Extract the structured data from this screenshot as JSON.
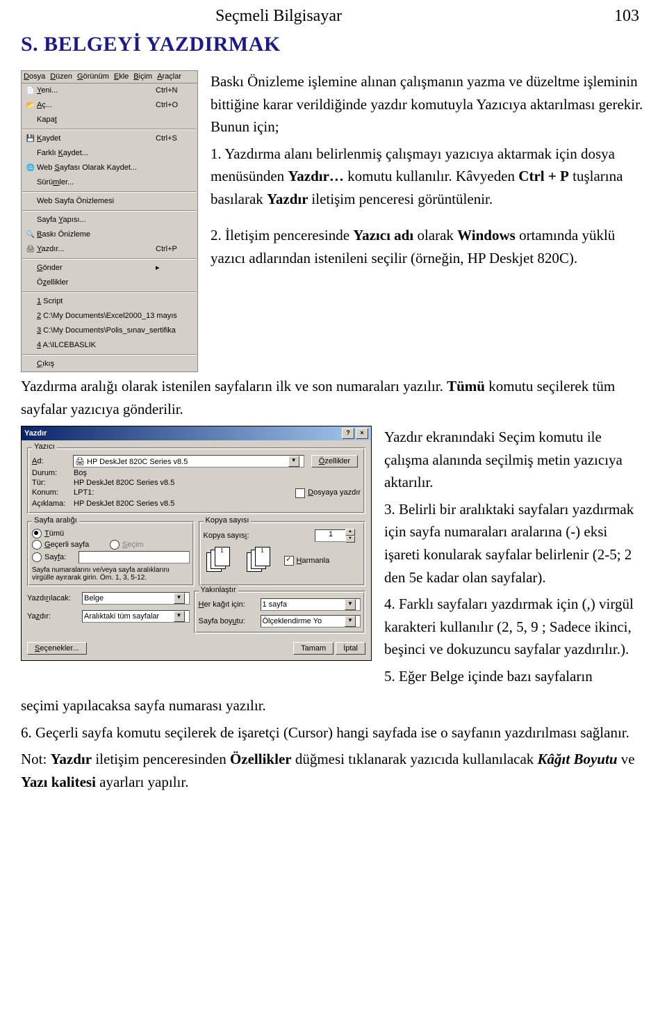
{
  "header": {
    "course": "Seçmeli Bilgisayar",
    "page": "103"
  },
  "section_title": "S. BELGEYİ YAZDIRMAK",
  "para_intro_1": "Baskı Önizleme işlemine alınan çalışmanın yazma ve düzeltme işleminin bittiğine karar verildiğinde yazdır komutuyla Yazıcıya aktarılması gerekir. Bunun için;",
  "para_step1_a": "1. Yazdırma alanı belirlenmiş çalışmayı yazıcıya aktarmak için dosya menüsünden ",
  "para_step1_b": "Yazdır…",
  "para_step1_c": " komutu  kullanılır. Kâvyeden ",
  "para_step1_d": "Ctrl + P",
  "para_step1_e": "  tuşlarına basılarak ",
  "para_step1_f": "Yazdır ",
  "para_step1_g": "iletişim penceresi görüntülenir.",
  "para_step2_a": "2. İletişim penceresinde ",
  "para_step2_b": "Yazıcı adı",
  "para_step2_c": " olarak ",
  "para_step2_d": "Windows",
  "para_step2_e": " ortamında yüklü yazıcı adlarından istenileni seçilir (örneğin, HP Deskjet 820C).",
  "para_mid_a": "Yazdırma aralığı olarak istenilen sayfaların ilk ve son numaraları yazılır. ",
  "para_mid_b": "Tümü",
  "para_mid_c": " komutu seçilerek  tüm sayfalar yazıcıya gönderilir.",
  "right_1": "Yazdır ekranındaki Seçim komutu ile çalışma alanında seçilmiş metin yazıcıya aktarılır.",
  "right_2": " 3. Belirli bir aralıktaki sayfaları yazdırmak için sayfa numaraları aralarına (-) eksi işareti konularak sayfalar belirlenir   (2-5; 2 den 5e kadar olan sayfalar).",
  "right_3": "4. Farklı sayfaları yazdırmak için (,) virgül karakteri kullanılır (2, 5, 9 ; Sadece  ikinci, beşinci ve dokuzuncu sayfalar yazdırılır.).",
  "right_4": "5. Eğer Belge içinde bazı sayfaların",
  "foot_1": "seçimi yapılacaksa sayfa numarası yazılır.",
  "foot_2": "6. Geçerli sayfa komutu seçilerek de işaretçi (Cursor) hangi sayfada ise o sayfanın yazdırılması sağlanır.",
  "foot_3a": "Not:  ",
  "foot_3b": "Yazdır",
  "foot_3c": " iletişim penceresinden ",
  "foot_3d": "Özellikler",
  "foot_3e": " düğmesi tıklanarak yazıcıda kullanılacak ",
  "foot_3f": "Kâğıt Boyutu",
  "foot_3g": " ve ",
  "foot_3h": "Yazı kalitesi",
  "foot_3i": " ayarları yapılır.",
  "menu": {
    "bar": [
      "Dosya",
      "Düzen",
      "Görünüm",
      "Ekle",
      "Biçim",
      "Araçlar"
    ],
    "bar_ul_idx": [
      0,
      0,
      0,
      0,
      0,
      0
    ],
    "items": [
      {
        "icon": "📄",
        "label": "Yeni...",
        "sc": "Ctrl+N",
        "ul": 0
      },
      {
        "icon": "📂",
        "label": "Aç...",
        "sc": "Ctrl+O",
        "ul": 0
      },
      {
        "icon": "",
        "label": "Kapat",
        "sc": "",
        "ul": 4
      },
      {
        "sep": true
      },
      {
        "icon": "💾",
        "label": "Kaydet",
        "sc": "Ctrl+S",
        "ul": 0
      },
      {
        "icon": "",
        "label": "Farklı Kaydet...",
        "sc": "",
        "ul": 7
      },
      {
        "icon": "🌐",
        "label": "Web Sayfası Olarak Kaydet...",
        "sc": "",
        "ul": 4
      },
      {
        "icon": "",
        "label": "Sürümler...",
        "sc": "",
        "ul": 4
      },
      {
        "sep": true
      },
      {
        "icon": "",
        "label": "Web Sayfa Önizlemesi",
        "sc": "",
        "ul": -1
      },
      {
        "sep": true
      },
      {
        "icon": "",
        "label": "Sayfa Yapısı...",
        "sc": "",
        "ul": 6
      },
      {
        "icon": "🔍",
        "label": "Baskı Önizleme",
        "sc": "",
        "ul": 0
      },
      {
        "icon": "🖨",
        "label": "Yazdır...",
        "sc": "Ctrl+P",
        "ul": 0
      },
      {
        "sep": true
      },
      {
        "icon": "",
        "label": "Gönder",
        "sc": "▸",
        "ul": 0
      },
      {
        "icon": "",
        "label": "Özellikler",
        "sc": "",
        "ul": 1
      },
      {
        "sep": true
      },
      {
        "icon": "",
        "label": "1 Script",
        "sc": "",
        "ul": 0
      },
      {
        "icon": "",
        "label": "2 C:\\My Documents\\Excel2000_13 mayıs",
        "sc": "",
        "ul": 0
      },
      {
        "icon": "",
        "label": "3 C:\\My Documents\\Polis_sınav_sertifika",
        "sc": "",
        "ul": 0
      },
      {
        "icon": "",
        "label": "4 A:\\ILCEBASLIK",
        "sc": "",
        "ul": 0
      },
      {
        "sep": true
      },
      {
        "icon": "",
        "label": "Çıkış",
        "sc": "",
        "ul": 0
      }
    ]
  },
  "dlg": {
    "title": "Yazdır",
    "printer_gb": "Yazıcı",
    "name_lbl": "Ad:",
    "name_val": "HP DeskJet 820C Series v8.5",
    "props_btn": "Özellikler",
    "status_lbl": "Durum:",
    "status_val": "Boş",
    "type_lbl": "Tür:",
    "type_val": "HP DeskJet 820C Series v8.5",
    "where_lbl": "Konum:",
    "where_val": "LPT1:",
    "comment_lbl": "Açıklama:",
    "comment_val": "HP DeskJet 820C Series v8.5",
    "tofile_lbl": "Dosyaya yazdır",
    "range_gb": "Sayfa aralığı",
    "r_all": "Tümü",
    "r_cur": "Geçerli sayfa",
    "r_sel": "Seçim",
    "r_pages": "Sayfa:",
    "r_help": "Sayfa numaralarını ve/veya sayfa aralıklarını virgülle ayırarak girin. Örn. 1, 3, 5-12.",
    "copies_gb": "Kopya sayısı",
    "copies_lbl": "Kopya sayısı:",
    "copies_val": "1",
    "collate": "Harmanla",
    "zoom_gb": "Yakınlaştır",
    "what_lbl": "Yazdırılacak:",
    "what_val": "Belge",
    "print_lbl": "Yazdır:",
    "print_val": "Aralıktaki tüm sayfalar",
    "persheet_lbl": "Her kağıt için:",
    "persheet_val": "1 sayfa",
    "scale_lbl": "Sayfa boyutu:",
    "scale_val": "Ölçeklendirme Yo",
    "options": "Seçenekler...",
    "ok": "Tamam",
    "cancel": "İptal"
  }
}
